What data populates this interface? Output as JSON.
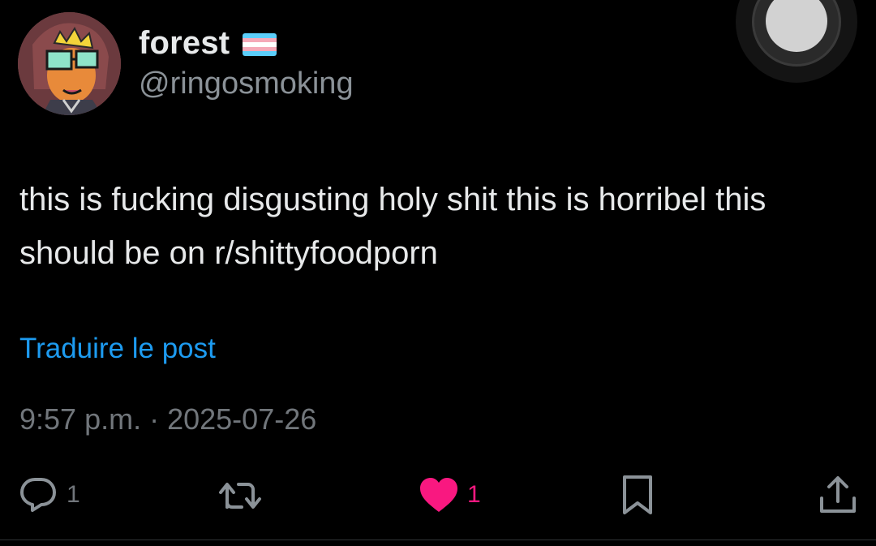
{
  "author": {
    "display_name": "forest",
    "handle": "@ringosmoking",
    "flag_icon": "transgender-flag-icon",
    "flag_colors": [
      "#5bcefa",
      "#f5a9b8",
      "#ffffff",
      "#f5a9b8",
      "#5bcefa"
    ]
  },
  "post": {
    "text": "this is fucking disgusting holy shit this is horribel this should be on r/shittyfoodporn",
    "translate_label": "Traduire le post",
    "time": "9:57 p.m.",
    "separator": "·",
    "date": "2025-07-26"
  },
  "actions": {
    "reply": {
      "icon": "reply-icon",
      "count": "1"
    },
    "repost": {
      "icon": "repost-icon",
      "count": ""
    },
    "like": {
      "icon": "heart-icon",
      "count": "1",
      "liked": true
    },
    "bookmark": {
      "icon": "bookmark-icon"
    },
    "share": {
      "icon": "share-icon"
    }
  },
  "colors": {
    "background": "#000000",
    "text": "#e7e9ea",
    "secondary": "#71767b",
    "link": "#1d9bf0",
    "like": "#f91880"
  }
}
